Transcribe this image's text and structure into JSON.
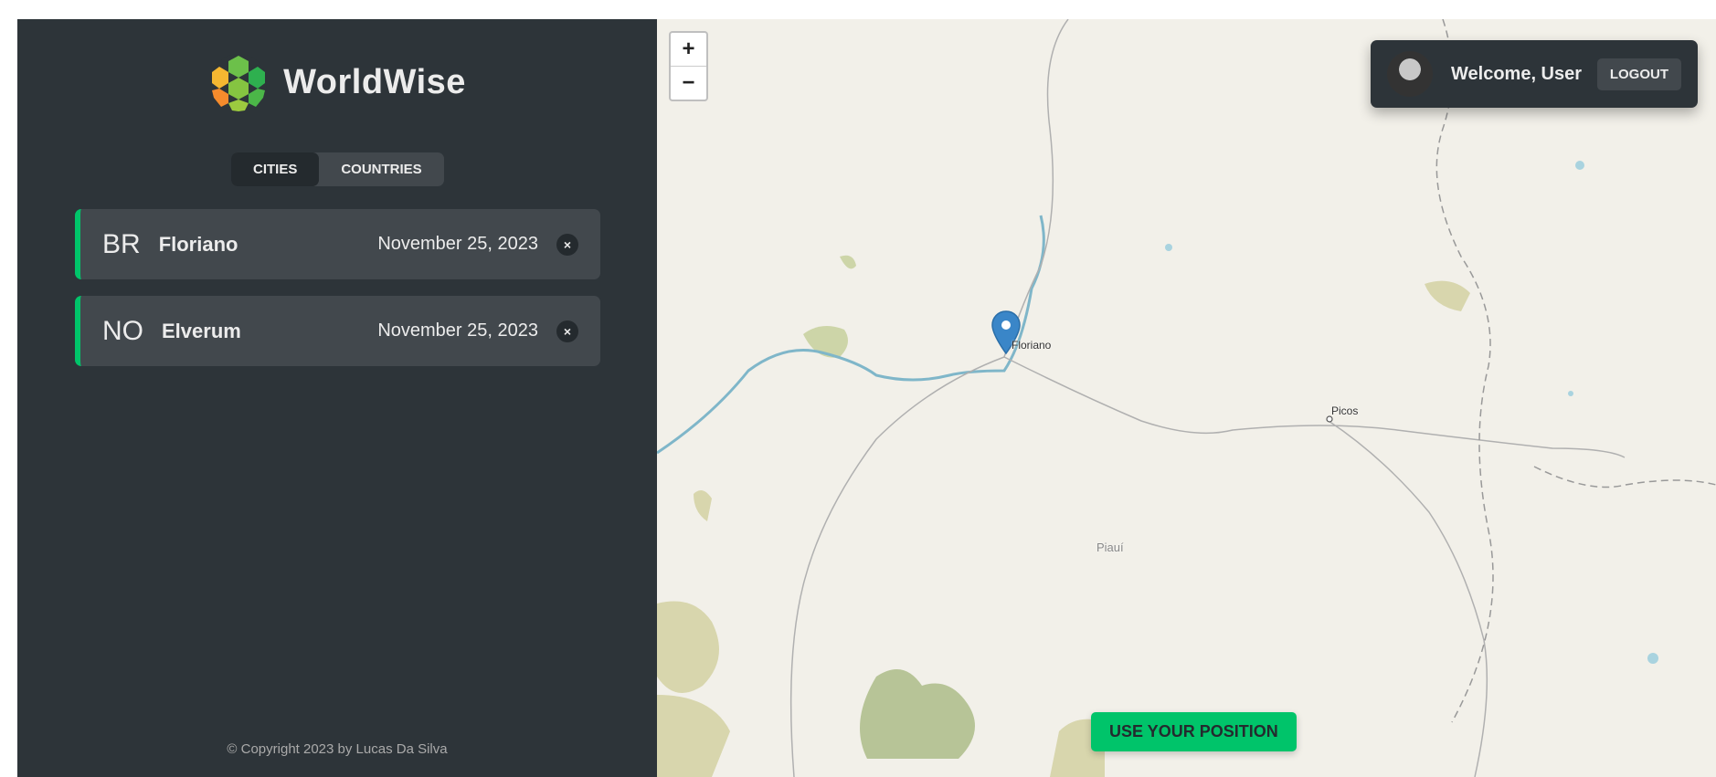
{
  "brand": {
    "name": "WorldWise"
  },
  "tabs": [
    {
      "label": "CITIES",
      "active": true
    },
    {
      "label": "COUNTRIES",
      "active": false
    }
  ],
  "cities": [
    {
      "code": "BR",
      "name": "Floriano",
      "date": "November 25, 2023",
      "delete_label": "×"
    },
    {
      "code": "NO",
      "name": "Elverum",
      "date": "November 25, 2023",
      "delete_label": "×"
    }
  ],
  "footer": {
    "copyright": "© Copyright 2023 by Lucas Da Silva"
  },
  "map": {
    "zoom_in_label": "+",
    "zoom_out_label": "−",
    "labels": {
      "floriano": "Floriano",
      "picos": "Picos",
      "state": "Piauí"
    },
    "use_position_label": "USE YOUR POSITION"
  },
  "user": {
    "welcome": "Welcome, User",
    "logout_label": "LOGOUT"
  },
  "colors": {
    "brand_green": "#00c46a",
    "sidebar_bg": "#2d3439",
    "card_bg": "#42484d",
    "map_bg": "#f2f0e9"
  }
}
